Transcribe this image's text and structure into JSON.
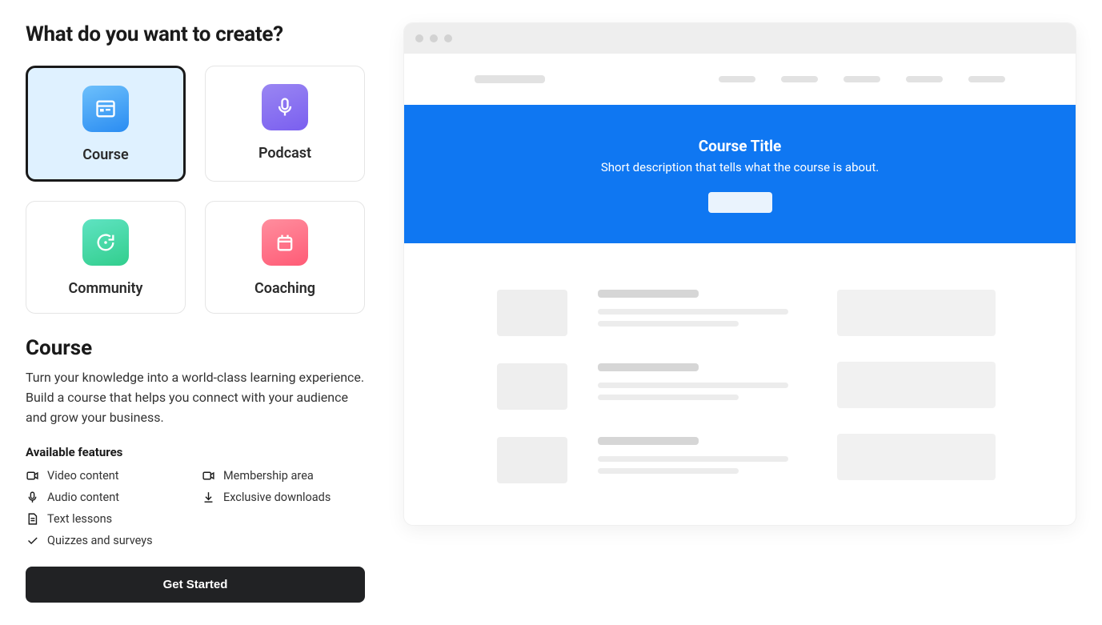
{
  "page": {
    "title": "What do you want to create?"
  },
  "types": {
    "course": {
      "label": "Course"
    },
    "podcast": {
      "label": "Podcast"
    },
    "community": {
      "label": "Community"
    },
    "coaching": {
      "label": "Coaching"
    }
  },
  "detail": {
    "title": "Course",
    "description": "Turn your knowledge into a world-class learning experience. Build a course that helps you connect with your audience and grow your business.",
    "features_title": "Available features"
  },
  "features": {
    "video": "Video content",
    "audio": "Audio content",
    "text": "Text lessons",
    "quizzes": "Quizzes and surveys",
    "membership": "Membership area",
    "downloads": "Exclusive downloads"
  },
  "cta": {
    "label": "Get Started"
  },
  "preview": {
    "hero_title": "Course Title",
    "hero_subtitle": "Short description that tells what the course is about."
  }
}
